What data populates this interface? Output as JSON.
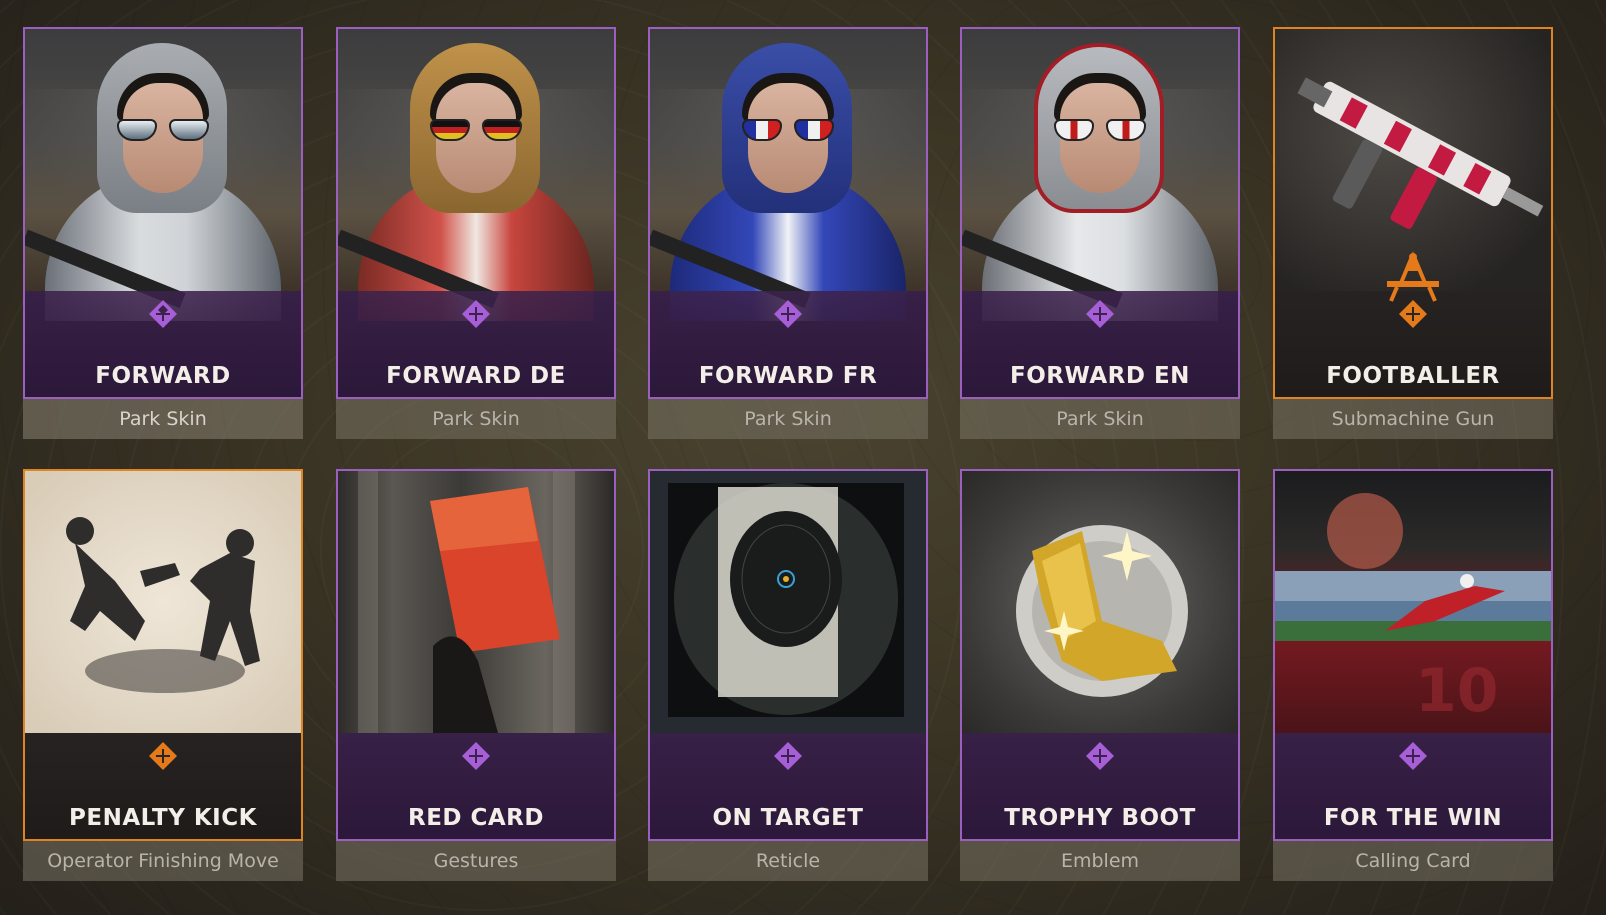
{
  "colors": {
    "legendary": "#9b5fc0",
    "epic_orange": "#e08422",
    "text_name": "#f3efe8",
    "text_sub": "#b9b4aa"
  },
  "items": [
    {
      "name": "FORWARD",
      "type": "Park Skin",
      "rarity_icon": "purple-diamond-icon",
      "art": "operator-white-jacket"
    },
    {
      "name": "FORWARD DE",
      "type": "Park Skin",
      "rarity_icon": "purple-diamond-icon",
      "art": "operator-red-jacket"
    },
    {
      "name": "FORWARD FR",
      "type": "Park Skin",
      "rarity_icon": "purple-diamond-icon",
      "art": "operator-blue-jacket"
    },
    {
      "name": "FORWARD EN",
      "type": "Park Skin",
      "rarity_icon": "purple-diamond-icon",
      "art": "operator-white-red-jacket"
    },
    {
      "name": "FOOTBALLER",
      "type": "Submachine Gun",
      "rarity_icon": "orange-diamond-icon",
      "art": "smg-weapon"
    },
    {
      "name": "PENALTY KICK",
      "type": "Operator Finishing Move",
      "rarity_icon": "orange-diamond-icon",
      "art": "finishing-move-sketch"
    },
    {
      "name": "RED CARD",
      "type": "Gestures",
      "rarity_icon": "purple-diamond-icon",
      "art": "red-card-hand"
    },
    {
      "name": "ON TARGET",
      "type": "Reticle",
      "rarity_icon": "purple-diamond-icon",
      "art": "scope-reticle"
    },
    {
      "name": "TROPHY BOOT",
      "type": "Emblem",
      "rarity_icon": "purple-diamond-icon",
      "art": "golden-boot"
    },
    {
      "name": "FOR THE WIN",
      "type": "Calling Card",
      "rarity_icon": "purple-diamond-icon",
      "art": "stadium-kick"
    }
  ]
}
